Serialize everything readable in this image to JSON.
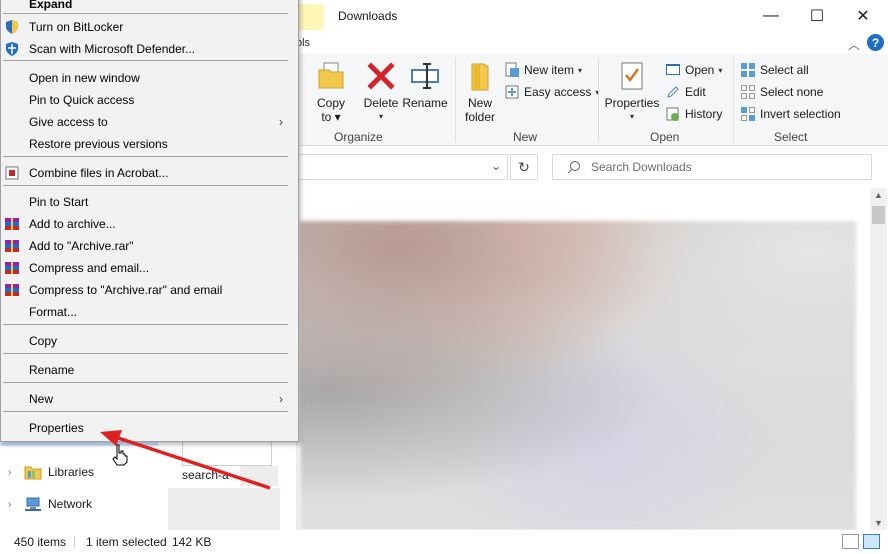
{
  "window": {
    "title": "Downloads",
    "tab_partial": "ols",
    "minimize": "—",
    "maximize": "☐",
    "close": "✕",
    "help": "?",
    "collapse_ribbon": "︿"
  },
  "ribbon": {
    "organize": {
      "label": "Organize",
      "partial_label": "e",
      "copy_to": "Copy",
      "copy_to_line2": "to ▾",
      "delete": "Delete",
      "delete_caret": "▾",
      "rename": "Rename"
    },
    "new": {
      "label": "New",
      "new_folder": "New",
      "new_folder_line2": "folder",
      "new_item": "New item",
      "easy_access": "Easy access"
    },
    "open": {
      "label": "Open",
      "properties": "Properties",
      "properties_caret": "▾",
      "open": "Open",
      "edit": "Edit",
      "history": "History"
    },
    "select": {
      "label": "Select",
      "select_all": "Select all",
      "select_none": "Select none",
      "invert_selection": "Invert selection"
    },
    "caret": "▾"
  },
  "address": {
    "dropdown": "⌄",
    "refresh": "↻",
    "search_placeholder": "Search Downloads"
  },
  "context_menu": {
    "items": [
      {
        "label": "Expand"
      },
      {
        "label": "Turn on BitLocker",
        "icon": "shield-icon"
      },
      {
        "label": "Scan with Microsoft Defender...",
        "icon": "defender-icon"
      },
      {
        "label": "Open in new window"
      },
      {
        "label": "Pin to Quick access"
      },
      {
        "label": "Give access to",
        "submenu": "›"
      },
      {
        "label": "Restore previous versions"
      },
      {
        "label": "Combine files in Acrobat...",
        "icon": "acrobat-icon"
      },
      {
        "label": "Pin to Start"
      },
      {
        "label": "Add to archive...",
        "icon": "winrar-icon"
      },
      {
        "label": "Add to \"Archive.rar\"",
        "icon": "winrar-icon"
      },
      {
        "label": "Compress and email...",
        "icon": "winrar-icon"
      },
      {
        "label": "Compress to \"Archive.rar\" and email",
        "icon": "winrar-icon"
      },
      {
        "label": "Format..."
      },
      {
        "label": "Copy"
      },
      {
        "label": "Rename"
      },
      {
        "label": "New",
        "submenu": "›"
      },
      {
        "label": "Properties"
      }
    ]
  },
  "nav_pane": {
    "items": [
      {
        "label": "Libraries",
        "icon": "libraries-icon",
        "chevron": "›"
      },
      {
        "label": "Network",
        "icon": "network-icon",
        "chevron": "›"
      }
    ]
  },
  "files": {
    "thumb_label": "search-a"
  },
  "status": {
    "item_count": "450 items",
    "selected": "1 item selected",
    "size": "142 KB"
  },
  "colors": {
    "accent": "#1e6ec8",
    "arrow": "#e02020",
    "selection": "#cce8ff"
  }
}
